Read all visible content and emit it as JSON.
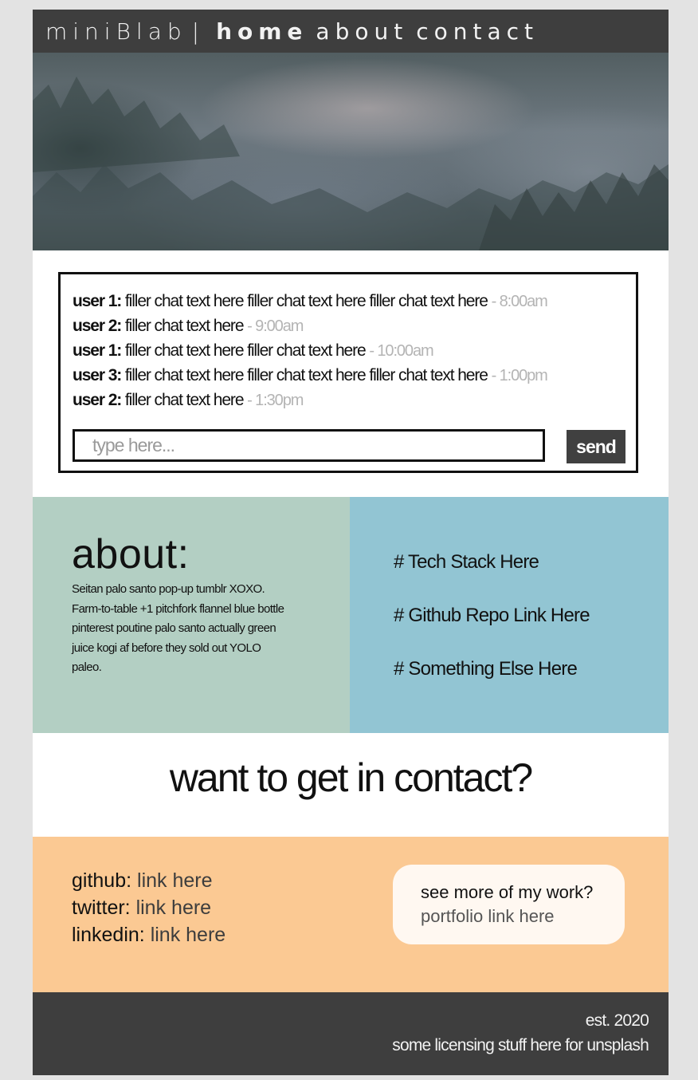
{
  "nav": {
    "brand": "miniBlab",
    "separator": "|",
    "links": [
      {
        "label": "home",
        "active": true
      },
      {
        "label": "about",
        "active": false
      },
      {
        "label": "contact",
        "active": false
      }
    ]
  },
  "chat": {
    "messages": [
      {
        "user": "user 1:",
        "text": "filler chat text here filler chat text here filler chat text here",
        "time": "- 8:00am"
      },
      {
        "user": "user 2:",
        "text": "filler chat text here",
        "time": "- 9:00am"
      },
      {
        "user": "user 1:",
        "text": "filler chat text here filler chat text here",
        "time": "- 10:00am"
      },
      {
        "user": "user 3:",
        "text": "filler chat text here filler chat text here filler chat text here",
        "time": "- 1:00pm"
      },
      {
        "user": "user 2:",
        "text": "filler chat text here",
        "time": "- 1:30pm"
      }
    ],
    "input_placeholder": "type here...",
    "input_value": "",
    "send_label": "send"
  },
  "about": {
    "heading": "about:",
    "body": "Seitan palo santo pop-up tumblr XOXO. Farm-to-table +1 pitchfork flannel blue bottle pinterest poutine palo santo actually green juice kogi af before they sold out YOLO paleo."
  },
  "links": [
    "# Tech Stack Here",
    "# Github Repo Link Here",
    "# Something Else Here"
  ],
  "contact": {
    "heading": "want to get in contact?",
    "socials": [
      {
        "label": "github:",
        "link": "link here"
      },
      {
        "label": "twitter:",
        "link": "link here"
      },
      {
        "label": "linkedin:",
        "link": "link here"
      }
    ],
    "portfolio": {
      "question": "see more of my work?",
      "link": "portfolio link here"
    }
  },
  "footer": {
    "est": "est. 2020",
    "licensing": "some licensing stuff here for unsplash"
  },
  "colors": {
    "nav_bg": "#3e3e3e",
    "about_bg": "#b3cfc3",
    "links_bg": "#92c5d3",
    "contact_bg": "#fbc993",
    "card_bg": "#fff8f1",
    "footer_bg": "#3e3e3e",
    "timestamp": "#b4b4b4"
  }
}
